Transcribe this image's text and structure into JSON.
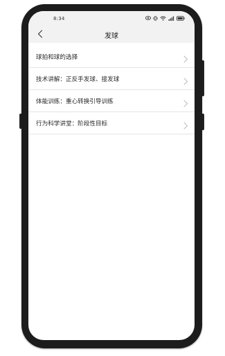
{
  "status_bar": {
    "time": "8:34",
    "icons": [
      "eye-icon",
      "vibrate-icon",
      "wifi-icon",
      "signal-icon",
      "battery-icon"
    ]
  },
  "nav": {
    "back_icon": "chevron-left-icon",
    "title": "发球"
  },
  "list": {
    "items": [
      {
        "label": "球拍和球的选择"
      },
      {
        "label": "技术讲解：正反手发球、接发球"
      },
      {
        "label": "体能训练：重心转换引导训练"
      },
      {
        "label": "行为科学讲堂：阶段性目标"
      }
    ]
  },
  "colors": {
    "header_bg": "#f2f2f2",
    "screen_bg": "#ffffff",
    "phone_frame": "#1c1c1c",
    "divider": "#e4e4e4",
    "chevron": "#b8b8b8"
  }
}
